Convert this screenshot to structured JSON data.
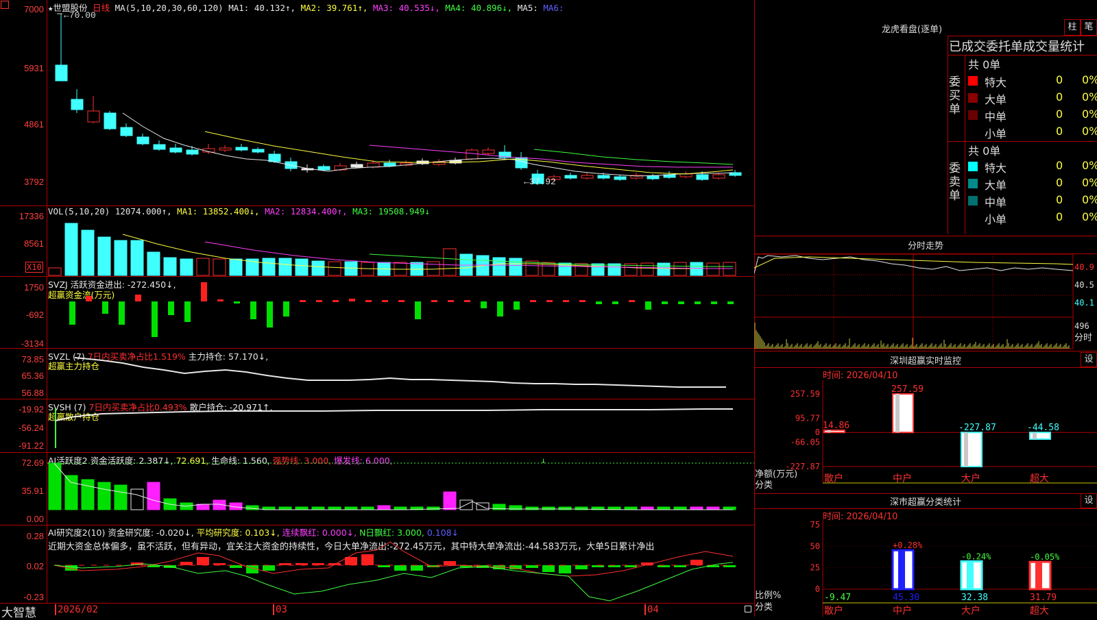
{
  "stock": {
    "star": "★",
    "name": "世盟股份",
    "period": "日线"
  },
  "k": {
    "ma_hdr": "MA(5,10,20,30,60,120)",
    "ma1": "MA1: 40.132↑,",
    "ma2": "MA2: 39.761↑,",
    "ma3": "MA3: 40.535↓,",
    "ma4": "MA4: 40.896↓,",
    "ma5": "MA5:",
    "ma6": "MA6:",
    "y": [
      "7000",
      "5931",
      "4861",
      "3792"
    ],
    "high_label": "←70.00",
    "low_label": "←37.92"
  },
  "vol": {
    "hdr": "VOL(5,10,20)",
    "v": "12074.000↑,",
    "ma1": "MA1: 13852.400↓,",
    "ma2": "MA2: 12834.400↑,",
    "ma3": "MA3: 19508.949↓",
    "y": [
      "17336",
      "8561"
    ],
    "x10": "X10"
  },
  "svzj": {
    "hdr": "SVZJ  活跃资金进出: -272.450↓,",
    "sub": "超赢资金流(万元)",
    "y": [
      "1750",
      "-692",
      "-3134"
    ]
  },
  "svzl": {
    "hdr": "SVZL (7)",
    "t2": "7日内买卖净占比1.519%",
    "t3": "主力持仓: 57.170↓,",
    "sub": "超赢主力持仓",
    "y": [
      "73.85",
      "65.36",
      "56.88"
    ]
  },
  "svsh": {
    "hdr": "SVSH (7)",
    "t2": "7日内买卖净占比0.493%",
    "t3": "散户持仓: -20.971↑,",
    "sub": "超赢散户持仓",
    "y": [
      "-19.92",
      "-56.24",
      "-91.22"
    ]
  },
  "ai1": {
    "hdr": "AI活跃度2",
    "t1": "资金活跃度: 2.387↓,",
    "t2": "72.691,",
    "t3": "生命线: 1.560,",
    "t4": "强势线: 3.000,",
    "t5": "爆发线: 6.000,",
    "y": [
      "72.69",
      "35.91",
      "0.00"
    ]
  },
  "ai2": {
    "hdr": "AI研究度2(10)",
    "t1": "资金研究度: -0.020↓,",
    "t2": "平均研究度: 0.103↓,",
    "t3": "连续飘红: 0.000↓,",
    "t4": "N日飘红: 3.000,",
    "t5": "0.108↓",
    "note": "近期大资金总体偏多，虽不活跃，但有异动，宜关注大资金的持续性，今日大单净流出:-272.45万元，其中特大单净流出:-44.583万元，大单5日累计净出",
    "y": [
      "0.28",
      "0.02",
      "-0.23"
    ]
  },
  "bottom": {
    "brand": "大智慧",
    "dates": [
      "2026/02",
      "03",
      "04"
    ]
  },
  "lhb": {
    "title": "龙虎看盘(逐单)",
    "btn1": "柱",
    "btn2": "笔",
    "subtitle": "已成交委托单成交量统计",
    "buy_label": "委买单",
    "buy_total": "共 0单",
    "sell_label": "委卖单",
    "sell_total": "共 0单",
    "buy_rows": [
      {
        "label": "特大",
        "v": "0",
        "p": "0%",
        "color": "#ff0000"
      },
      {
        "label": "大单",
        "v": "0",
        "p": "0%",
        "color": "#8b0000"
      },
      {
        "label": "中单",
        "v": "0",
        "p": "0%",
        "color": "#6b0000"
      },
      {
        "label": "小单",
        "v": "0",
        "p": "0%",
        "color": "#000000"
      }
    ],
    "sell_rows": [
      {
        "label": "特大",
        "v": "0",
        "p": "0%",
        "color": "#00ffff"
      },
      {
        "label": "大单",
        "v": "0",
        "p": "0%",
        "color": "#008b8b"
      },
      {
        "label": "中单",
        "v": "0",
        "p": "0%",
        "color": "#007070"
      },
      {
        "label": "小单",
        "v": "0",
        "p": "0%",
        "color": "#000000"
      }
    ]
  },
  "fenshi": {
    "title": "分时走势",
    "y": [
      "40.9",
      "40.5",
      "40.1",
      "496"
    ],
    "label": "分时"
  },
  "monitor": {
    "title": "深圳超赢实时监控",
    "btn": "设",
    "time": "时间: 2026/04/10",
    "y": [
      "257.59",
      "95.77",
      "0",
      "-66.05",
      "-227.87"
    ],
    "ylab": "净额(万元)",
    "xlab": "分类",
    "categories": [
      "散户",
      "中户",
      "大户",
      "超大"
    ],
    "values": [
      14.86,
      257.59,
      -227.87,
      -44.58
    ],
    "labels": [
      "14.86",
      "257.59",
      "-227.87",
      "-44.58"
    ]
  },
  "classify": {
    "title": "深市超赢分类统计",
    "btn": "设",
    "time": "时间: 2026/04/10",
    "y": [
      "75",
      "50",
      "25",
      "0"
    ],
    "ylab": "比例%",
    "xlab": "分类",
    "categories": [
      "散户",
      "中户",
      "大户",
      "超大"
    ],
    "values": [
      -9.47,
      45.3,
      32.38,
      31.79
    ],
    "bottom_labels": [
      "-9.47",
      "45.30",
      "32.38",
      "31.79"
    ],
    "top_labels": [
      "",
      "+0.28%",
      "-0.24%",
      "-0.05%"
    ]
  }
}
